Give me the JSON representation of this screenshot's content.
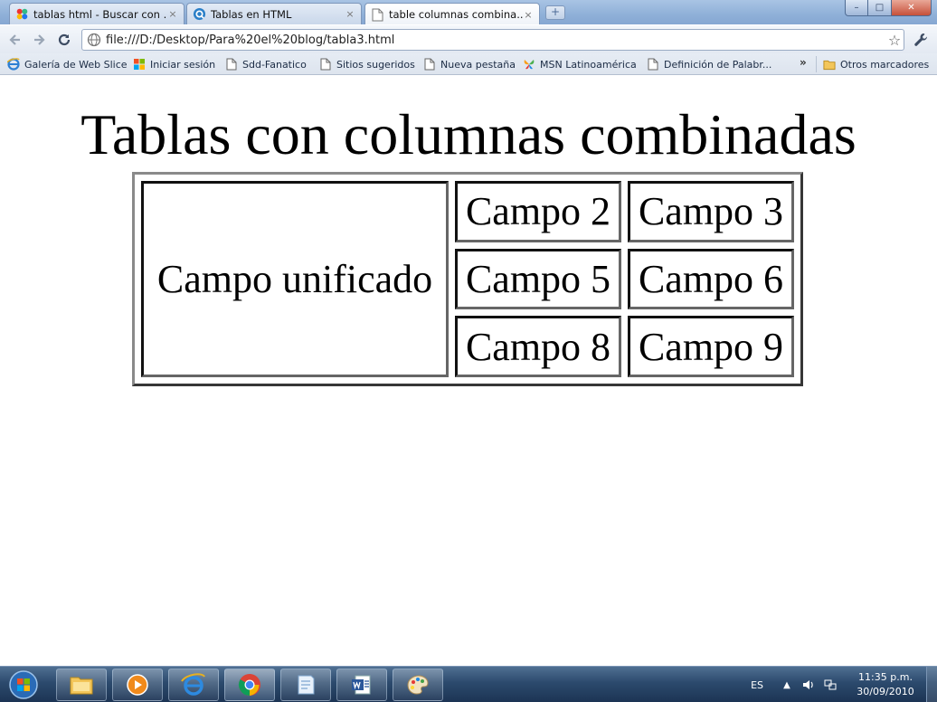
{
  "browser": {
    "tabs": [
      {
        "title": "tablas html - Buscar con ...",
        "favicon": "google-icon",
        "active": false
      },
      {
        "title": "Tablas en HTML",
        "favicon": "site-q-icon",
        "active": false
      },
      {
        "title": "table columnas combina...",
        "favicon": "document-icon",
        "active": true
      }
    ],
    "close_glyph": "×",
    "new_tab_glyph": "+",
    "window_controls": {
      "minimize": "–",
      "maximize": "□",
      "close": "✕"
    },
    "address": "file:///D:/Desktop/Para%20el%20blog/tabla3.html",
    "bookmarks": [
      {
        "label": "Galería de Web Slice",
        "icon": "ie-icon"
      },
      {
        "label": "Iniciar sesión",
        "icon": "windows-live-icon"
      },
      {
        "label": "Sdd-Fanatico",
        "icon": "document-icon"
      },
      {
        "label": "Sitios sugeridos",
        "icon": "document-icon"
      },
      {
        "label": "Nueva pestaña",
        "icon": "document-icon"
      },
      {
        "label": "MSN Latinoamérica",
        "icon": "msn-butterfly-icon"
      },
      {
        "label": "Definición de Palabr...",
        "icon": "document-icon"
      }
    ],
    "bookmarks_overflow": "»",
    "other_bookmarks": "Otros marcadores"
  },
  "page": {
    "title": "Tablas con columnas combinadas",
    "table": {
      "spanned_cell": "Campo unificado",
      "rows": [
        [
          "Campo 2",
          "Campo 3"
        ],
        [
          "Campo 5",
          "Campo 6"
        ],
        [
          "Campo 8",
          "Campo 9"
        ]
      ]
    }
  },
  "taskbar": {
    "apps": [
      "explorer-icon",
      "media-player-icon",
      "internet-explorer-icon",
      "chrome-icon",
      "notepad-icon",
      "word-icon",
      "paint-icon"
    ],
    "language": "ES",
    "time": "11:35 p.m.",
    "date": "30/09/2010"
  },
  "colors": {
    "tabstrip": "#8fb0d8",
    "toolbar": "#e3e9f2",
    "taskbar": "#2c4a6d"
  }
}
